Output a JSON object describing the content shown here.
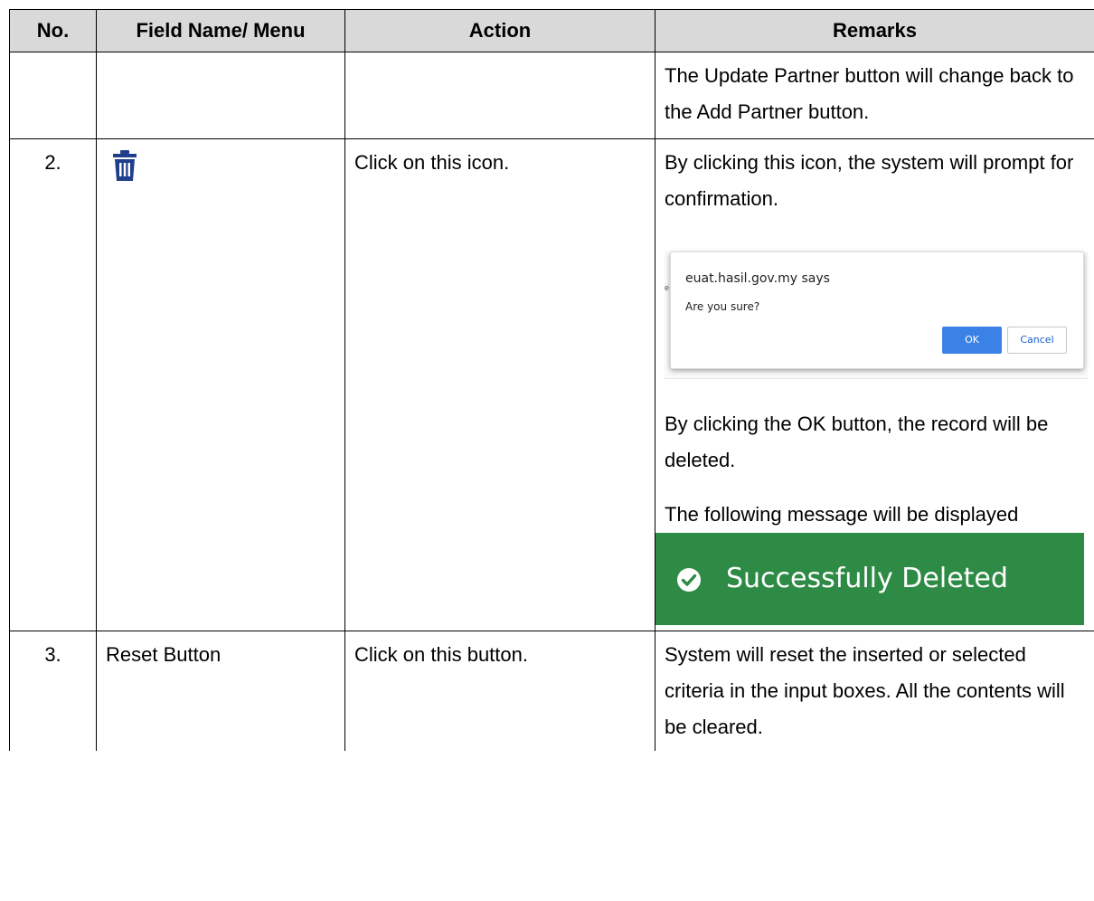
{
  "table": {
    "headers": {
      "no": "No.",
      "field": "Field Name/ Menu",
      "action": "Action",
      "remarks": "Remarks"
    },
    "rows": [
      {
        "no": "",
        "field": "",
        "action": "",
        "remarks": [
          "The Update Partner button will change back to the Add Partner button."
        ]
      },
      {
        "no": "2.",
        "field_icon": "trash-icon",
        "action": "Click on this icon.",
        "remarks_intro": "By clicking this icon, the system will prompt for confirmation.",
        "dialog": {
          "title": "euat.hasil.gov.my says",
          "message": "Are you sure?",
          "ok_label": "OK",
          "cancel_label": "Cancel"
        },
        "remarks_after_dialog": "By clicking the OK button, the record will be deleted.",
        "remarks_message_intro": "The following message will be displayed",
        "success_banner": {
          "icon": "check-circle-icon",
          "text": "Successfully Deleted",
          "color": "#2e8b45"
        }
      },
      {
        "no": "3.",
        "field": "Reset Button",
        "action": "Click on this button.",
        "remarks": "System will reset the inserted or selected criteria in the input boxes. All the contents will be cleared."
      }
    ]
  },
  "colors": {
    "header_bg": "#d9d9d9",
    "icon_blue": "#1f3f8c",
    "dialog_ok": "#3b82e6"
  }
}
